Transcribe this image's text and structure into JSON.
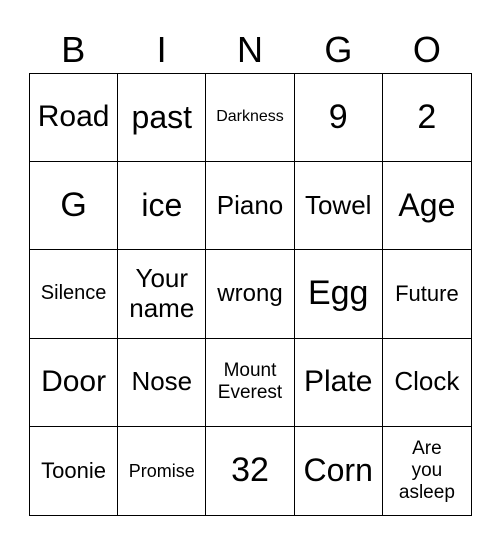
{
  "header": [
    "B",
    "I",
    "N",
    "G",
    "O"
  ],
  "cells": [
    "Road",
    "past",
    "Darkness",
    "9",
    "2",
    "G",
    "ice",
    "Piano",
    "Towel",
    "Age",
    "Silence",
    "Your name",
    "wrong",
    "Egg",
    "Future",
    "Door",
    "Nose",
    "Mount Everest",
    "Plate",
    "Clock",
    "Toonie",
    "Promise",
    "32",
    "Corn",
    "Are you asleep"
  ]
}
